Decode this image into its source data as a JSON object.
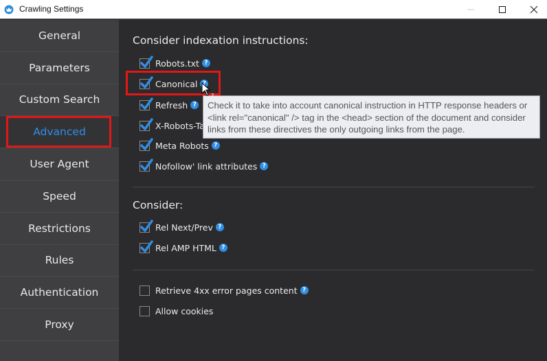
{
  "window": {
    "title": "Crawling Settings",
    "controls": [
      "minimize",
      "maximize",
      "close"
    ]
  },
  "sidebar": {
    "items": [
      {
        "label": "General",
        "active": false
      },
      {
        "label": "Parameters",
        "active": false
      },
      {
        "label": "Custom Search",
        "active": false
      },
      {
        "label": "Advanced",
        "active": true
      },
      {
        "label": "User Agent",
        "active": false
      },
      {
        "label": "Speed",
        "active": false
      },
      {
        "label": "Restrictions",
        "active": false
      },
      {
        "label": "Rules",
        "active": false
      },
      {
        "label": "Authentication",
        "active": false
      },
      {
        "label": "Proxy",
        "active": false
      }
    ]
  },
  "main": {
    "section1": {
      "title": "Consider indexation instructions:",
      "options": [
        {
          "label": "Robots.txt",
          "checked": true,
          "help": true
        },
        {
          "label": "Canonical",
          "checked": true,
          "help": true
        },
        {
          "label": "Refresh",
          "checked": true,
          "help": true
        },
        {
          "label": "X-Robots-Tag",
          "checked": true,
          "help": false
        },
        {
          "label": "Meta Robots",
          "checked": true,
          "help": true
        },
        {
          "label": "Nofollow' link attributes",
          "checked": true,
          "help": true
        }
      ]
    },
    "section2": {
      "title": "Consider:",
      "options": [
        {
          "label": "Rel Next/Prev",
          "checked": true,
          "help": true
        },
        {
          "label": "Rel AMP HTML",
          "checked": true,
          "help": true
        }
      ]
    },
    "section3": {
      "options": [
        {
          "label": "Retrieve 4xx error pages content",
          "checked": false,
          "help": true
        },
        {
          "label": "Allow cookies",
          "checked": false,
          "help": false
        }
      ]
    }
  },
  "tooltip": {
    "lines": [
      "Check it to take into account canonical instruction in HTTP response headers or",
      "<link rel=\"canonical\" /> tag in the <head> section of the document and consider",
      "links from these directives the only outgoing links from the page."
    ]
  },
  "help_glyph": "?",
  "colors": {
    "accent": "#2f8ee5",
    "highlight": "#e31717",
    "sidebar_bg": "#3f3f42",
    "content_bg": "#2b2b2d"
  }
}
